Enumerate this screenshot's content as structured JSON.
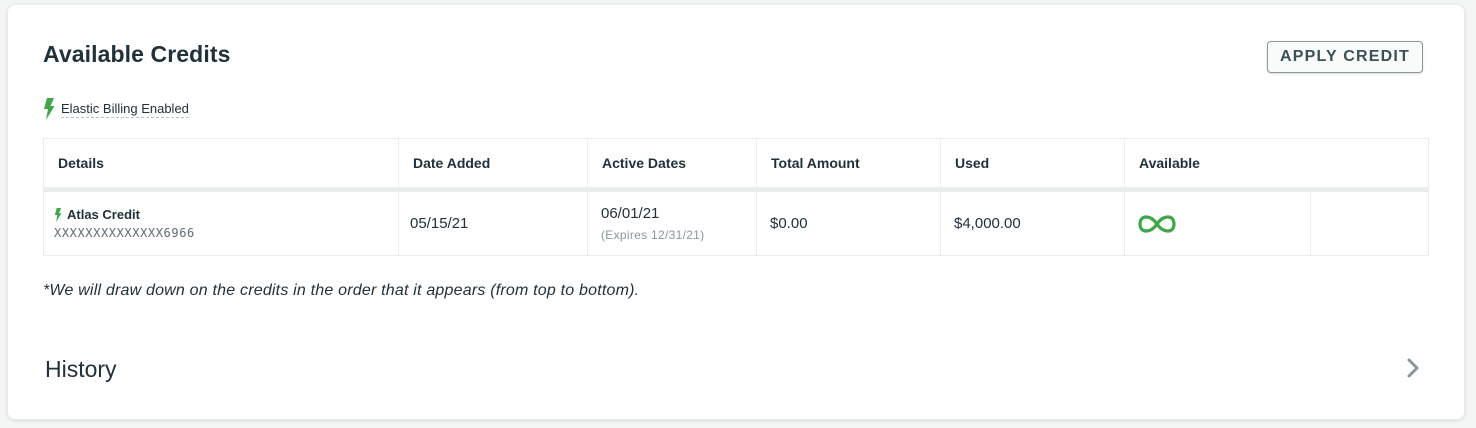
{
  "section": {
    "title": "Available Credits",
    "apply_button_label": "APPLY CREDIT",
    "elastic_billing_label": "Elastic Billing Enabled"
  },
  "table": {
    "headers": [
      "Details",
      "Date Added",
      "Active Dates",
      "Total Amount",
      "Used",
      "Available"
    ],
    "rows": [
      {
        "name": "Atlas Credit",
        "id": "XXXXXXXXXXXXXX6966",
        "date_added": "05/15/21",
        "active_start": "06/01/21",
        "expires": "(Expires 12/31/21)",
        "total_amount": "$0.00",
        "used": "$4,000.00",
        "available_icon": "infinity-icon"
      }
    ]
  },
  "footnote": "*We will draw down on the credits in the order that it appears (from top to bottom).",
  "history": {
    "title": "History",
    "expand_icon": "chevron-right-icon"
  },
  "colors": {
    "accent_green": "#3fa64a",
    "text": "#21313c",
    "border": "#e7eeec"
  }
}
